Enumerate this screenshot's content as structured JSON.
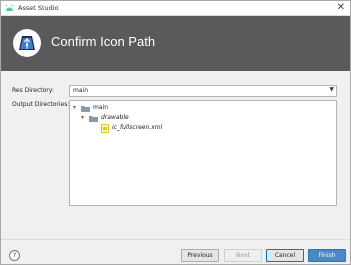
{
  "window": {
    "title": "Asset Studio",
    "close_glyph": "✕"
  },
  "banner": {
    "heading": "Confirm Icon Path",
    "logo_icon": "android-studio-icon"
  },
  "form": {
    "res_directory_label": "Res Directory:",
    "res_directory_value": "main",
    "output_directories_label": "Output Directories:"
  },
  "tree": [
    {
      "label": "main",
      "icon": "folder-icon",
      "italic": false,
      "expanded": true,
      "depth": 0
    },
    {
      "label": "drawable",
      "icon": "folder-icon",
      "italic": true,
      "expanded": true,
      "depth": 1
    },
    {
      "label": "ic_fullscreen.xml",
      "icon": "xml-file-icon",
      "italic": true,
      "expanded": false,
      "depth": 2
    }
  ],
  "buttons": {
    "help": "?",
    "previous": "Previous",
    "next": "Next",
    "cancel": "Cancel",
    "finish": "Finish"
  },
  "colors": {
    "banner_bg": "#5a5a5a",
    "finish_button": "#4a88c8",
    "focus_border": "#0078d7"
  }
}
